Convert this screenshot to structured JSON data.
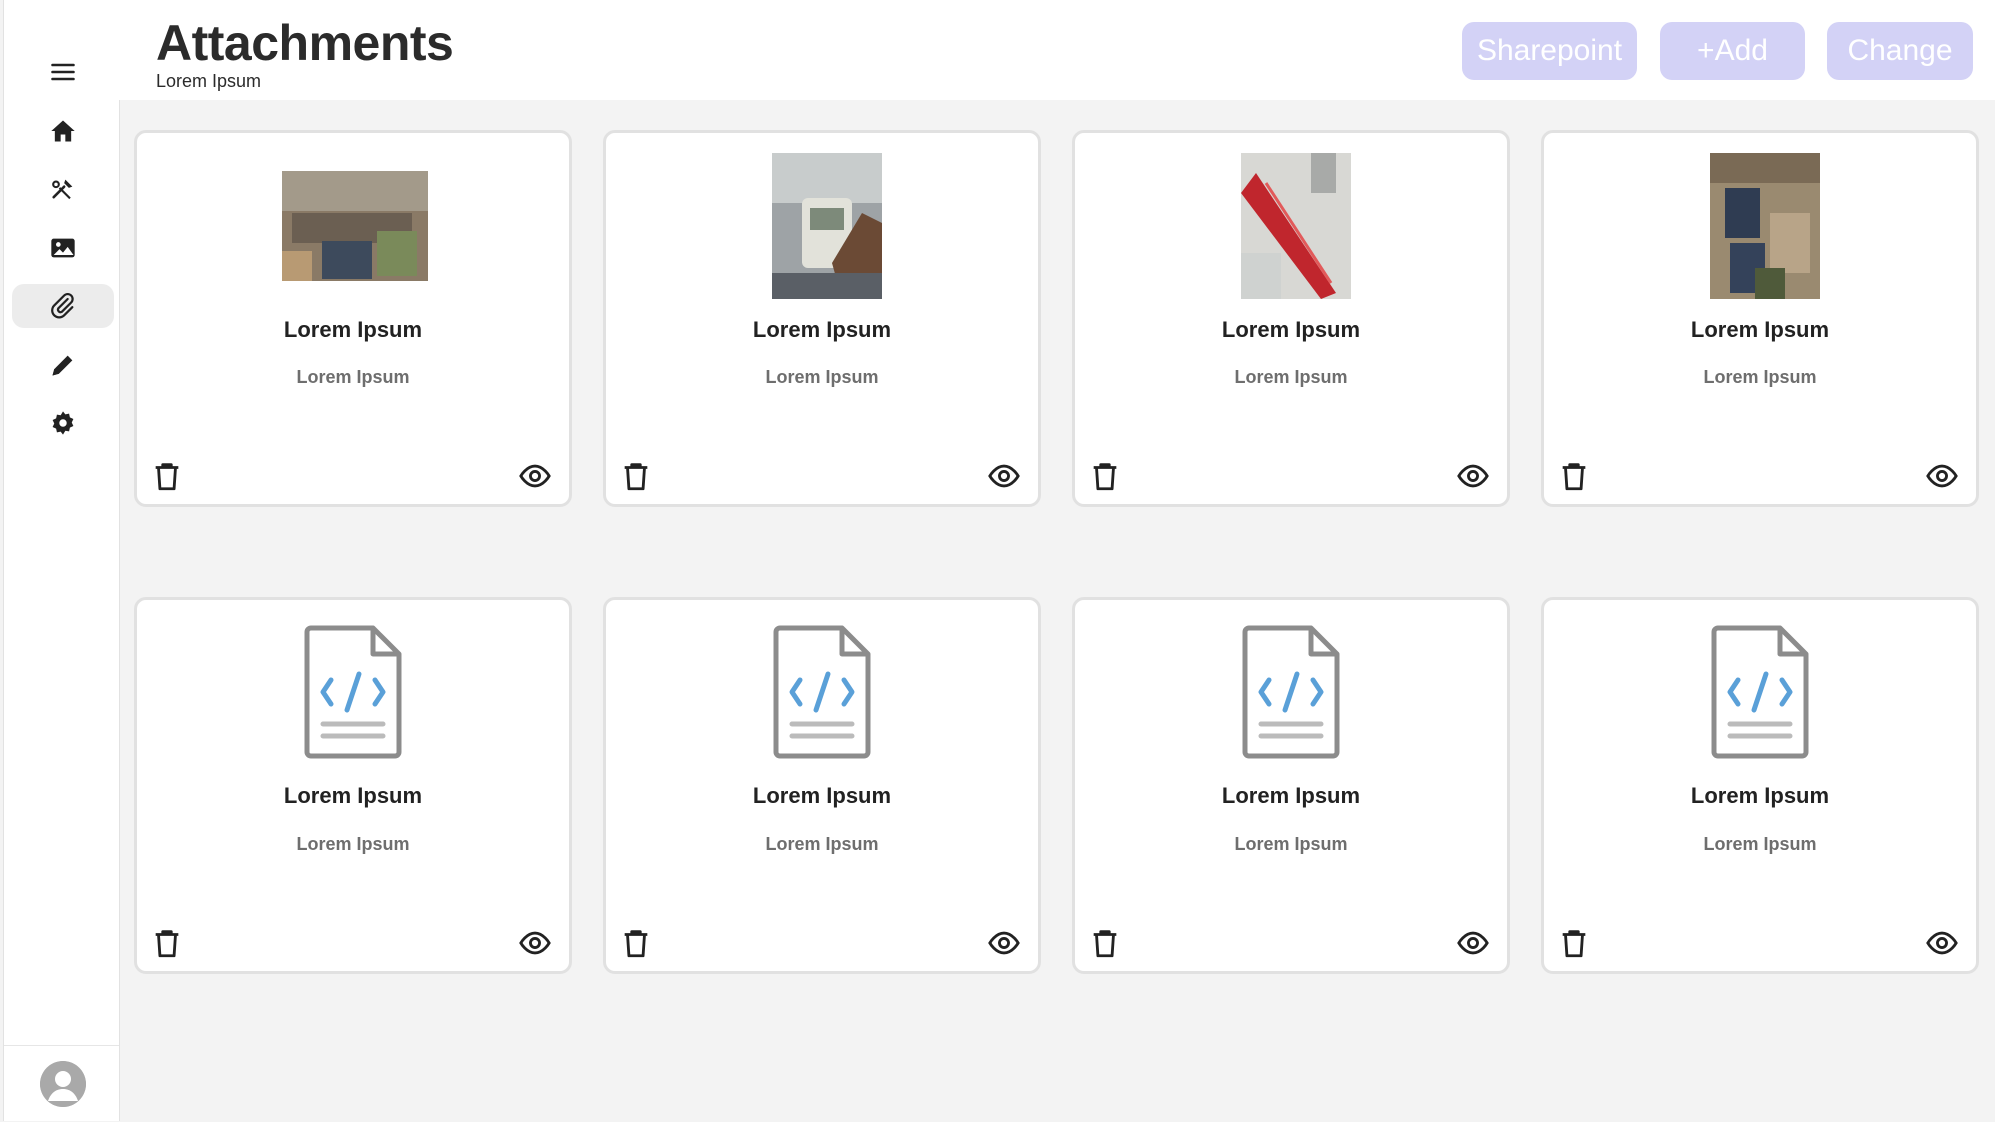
{
  "header": {
    "title": "Attachments",
    "subtitle": "Lorem Ipsum",
    "buttons": {
      "sharepoint": "Sharepoint",
      "add": "+Add",
      "change": "Change"
    }
  },
  "sidebar": {
    "items": [
      {
        "icon": "menu-icon"
      },
      {
        "icon": "home-icon"
      },
      {
        "icon": "tools-icon"
      },
      {
        "icon": "image-icon"
      },
      {
        "icon": "paperclip-icon",
        "active": true
      },
      {
        "icon": "pencil-icon"
      },
      {
        "icon": "gear-icon"
      }
    ],
    "avatar_icon": "user-avatar-icon"
  },
  "cards": [
    {
      "title": "Lorem Ipsum",
      "subtitle": "Lorem Ipsum",
      "type": "photo"
    },
    {
      "title": "Lorem Ipsum",
      "subtitle": "Lorem Ipsum",
      "type": "photo"
    },
    {
      "title": "Lorem Ipsum",
      "subtitle": "Lorem Ipsum",
      "type": "photo"
    },
    {
      "title": "Lorem Ipsum",
      "subtitle": "Lorem Ipsum",
      "type": "photo"
    },
    {
      "title": "Lorem Ipsum",
      "subtitle": "Lorem Ipsum",
      "type": "code-file"
    },
    {
      "title": "Lorem Ipsum",
      "subtitle": "Lorem Ipsum",
      "type": "code-file"
    },
    {
      "title": "Lorem Ipsum",
      "subtitle": "Lorem Ipsum",
      "type": "code-file"
    },
    {
      "title": "Lorem Ipsum",
      "subtitle": "Lorem Ipsum",
      "type": "code-file"
    }
  ],
  "colors": {
    "accent_button": "#d3d2f6",
    "file_icon_gray": "#8c8c8c",
    "code_blue": "#5aa0d8",
    "page_bg": "#f3f3f3"
  }
}
